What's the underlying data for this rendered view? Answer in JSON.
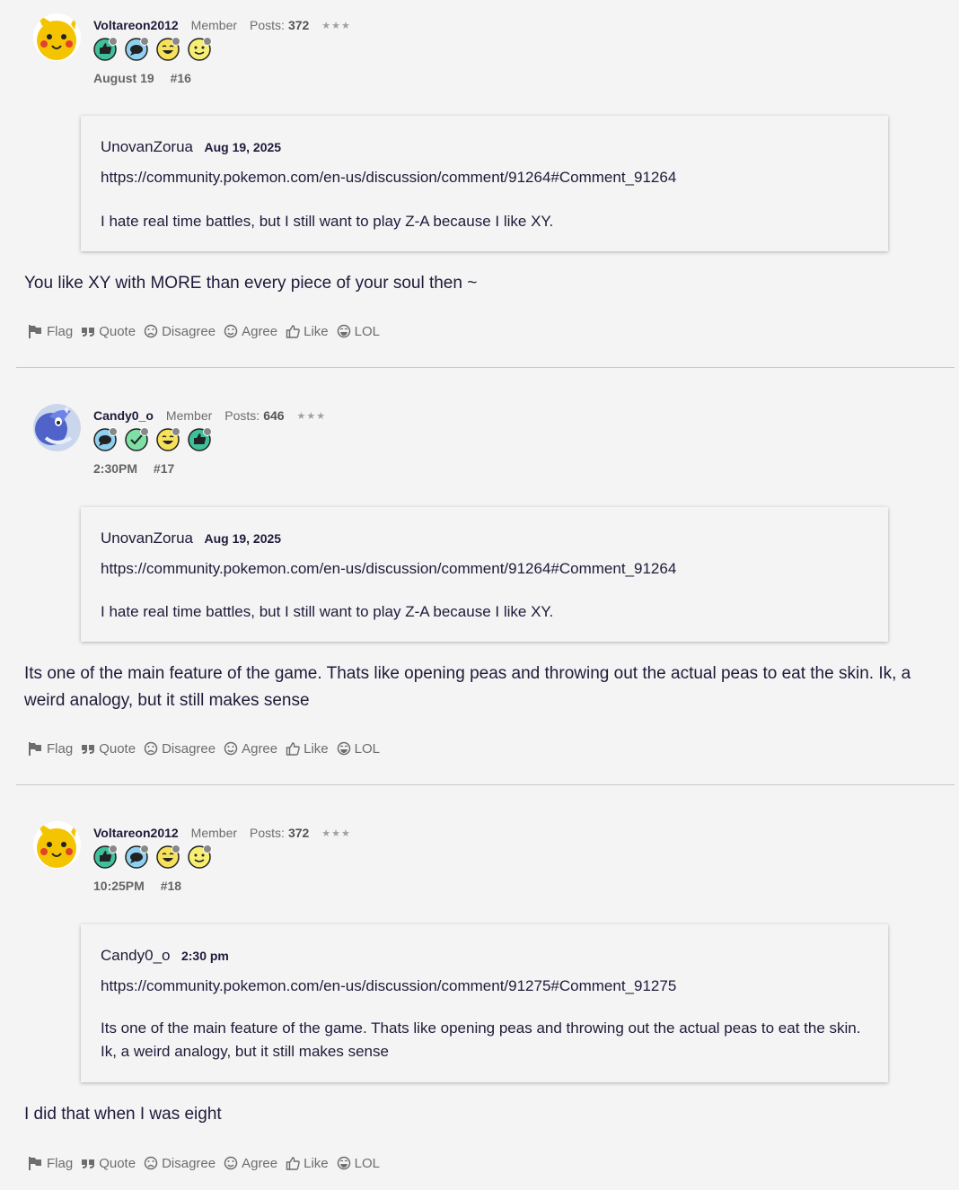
{
  "actions": {
    "flag": "Flag",
    "quote": "Quote",
    "disagree": "Disagree",
    "agree": "Agree",
    "like": "Like",
    "lol": "LOL"
  },
  "posts": [
    {
      "author": "Voltareon2012",
      "role": "Member",
      "posts_label": "Posts:",
      "posts_count": "372",
      "rank": "★★★",
      "date": "August 19",
      "number": "#16",
      "avatar": "pikachu-avatar",
      "badges": [
        "first-like-badge",
        "first-comment-badge",
        "laugh-badge",
        "smile-badge"
      ],
      "quote": {
        "author": "UnovanZorua",
        "date": "Aug 19, 2025",
        "link": "https://community.pokemon.com/en-us/discussion/comment/91264#Comment_91264",
        "text": "I hate real time battles, but I still want to play Z-A because I like XY."
      },
      "body": "You like XY with MORE than every piece of your soul then ~"
    },
    {
      "author": "Candy0_o",
      "role": "Member",
      "posts_label": "Posts:",
      "posts_count": "646",
      "rank": "★★★",
      "date": "2:30PM",
      "number": "#17",
      "avatar": "dragonair-avatar",
      "badges": [
        "first-comment-badge",
        "check-badge",
        "laugh-badge",
        "first-like-badge"
      ],
      "quote": {
        "author": "UnovanZorua",
        "date": "Aug 19, 2025",
        "link": "https://community.pokemon.com/en-us/discussion/comment/91264#Comment_91264",
        "text": "I hate real time battles, but I still want to play Z-A because I like XY."
      },
      "body": "Its one of the main feature of the game. Thats like opening peas and throwing out the actual peas to eat the skin. Ik, a weird analogy, but it still makes sense"
    },
    {
      "author": "Voltareon2012",
      "role": "Member",
      "posts_label": "Posts:",
      "posts_count": "372",
      "rank": "★★★",
      "date": "10:25PM",
      "number": "#18",
      "avatar": "pikachu-avatar",
      "badges": [
        "first-like-badge",
        "first-comment-badge",
        "laugh-badge",
        "smile-badge"
      ],
      "quote": {
        "author": "Candy0_o",
        "date": "2:30 pm",
        "link": "https://community.pokemon.com/en-us/discussion/comment/91275#Comment_91275",
        "text": "Its one of the main feature of the game. Thats like opening peas and throwing out the actual peas to eat the skin. Ik, a weird analogy, but it still makes sense"
      },
      "body": "I did that when I was eight"
    }
  ]
}
